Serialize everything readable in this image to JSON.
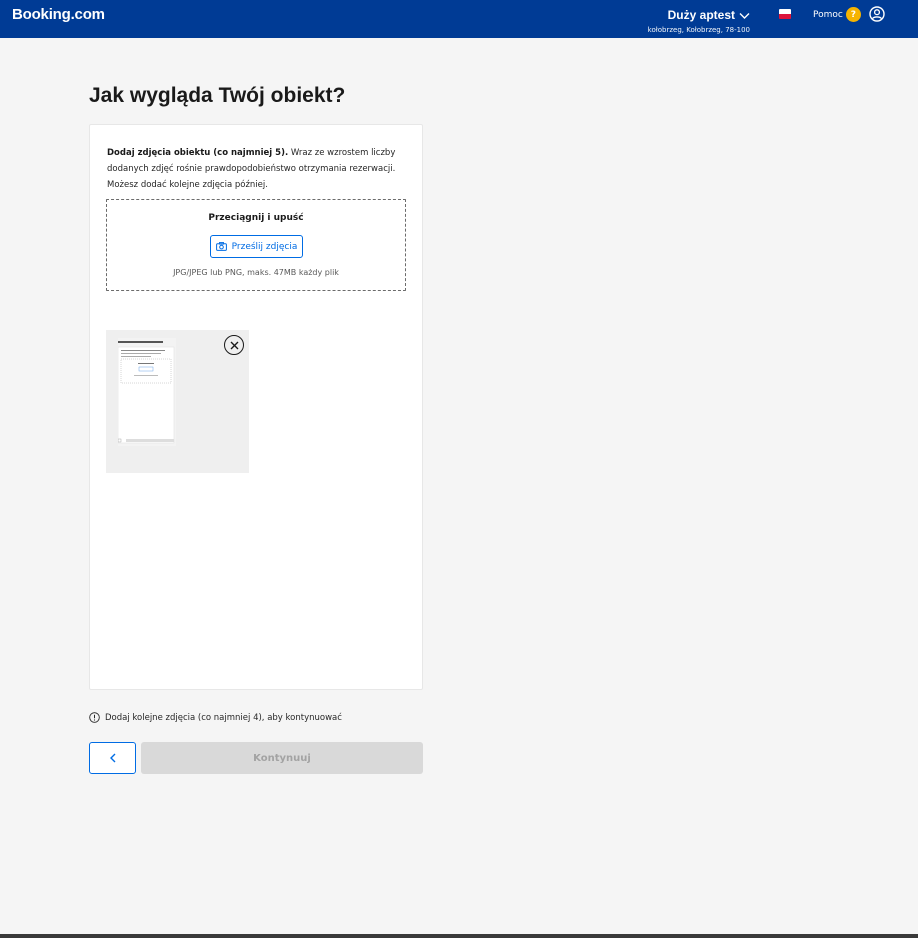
{
  "header": {
    "logo": "Booking.com",
    "property_name": "Duży aptest",
    "property_address": "kołobrzeg, Kołobrzeg, 78-100",
    "help_label": "Pomoc",
    "help_badge": "?",
    "brand_color": "#003b95"
  },
  "page": {
    "title": "Jak wygląda Twój obiekt?"
  },
  "photos": {
    "intro_bold": "Dodaj zdjęcia obiektu (co najmniej 5).",
    "intro_rest": " Wraz ze wzrostem liczby dodanych zdjęć rośnie prawdopodobieństwo otrzymania rezerwacji. Możesz dodać kolejne zdjęcia później.",
    "drop_title": "Przeciągnij i upuść",
    "upload_label": "Prześlij zdjęcia",
    "hint": "JPG/JPEG lub PNG, maks. 47MB każdy plik",
    "accent_color": "#006ce4"
  },
  "footer": {
    "notice": "Dodaj kolejne zdjęcia (co najmniej 4), aby kontynuować",
    "continue_label": "Kontynuuj"
  },
  "icons": {
    "chevron": "chevron-down-icon",
    "account": "account-icon",
    "camera": "camera-icon",
    "remove": "close-circle-icon",
    "info": "info-icon",
    "back": "chevron-left-icon"
  }
}
